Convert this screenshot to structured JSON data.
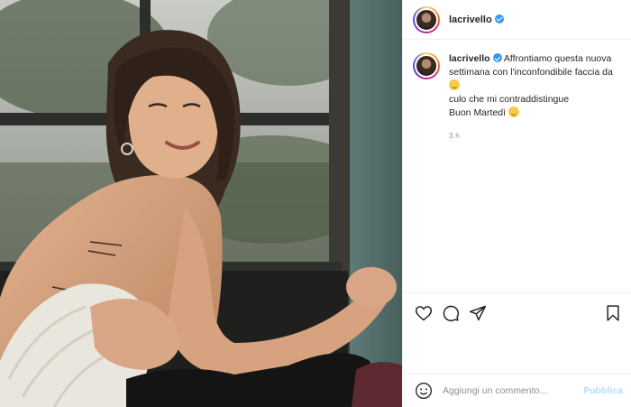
{
  "post": {
    "username": "lacrivello",
    "verified": true,
    "caption_lines": [
      "Affrontiamo questa nuova",
      "settimana con l'inconfondibile faccia da",
      "culo che mi contraddistingue",
      "Buon Martedì"
    ],
    "timestamp": "3 h"
  },
  "actions": {
    "like_icon": "heart-icon",
    "comment_icon": "comment-icon",
    "share_icon": "send-icon",
    "save_icon": "bookmark-icon"
  },
  "comment_box": {
    "placeholder": "Aggiungi un commento...",
    "publish_label": "Pubblica",
    "emoji_icon": "smile-icon"
  },
  "colors": {
    "verified_blue": "#3897f0",
    "publish_disabled": "#b2dffc",
    "meta_gray": "#8e8e8e"
  }
}
